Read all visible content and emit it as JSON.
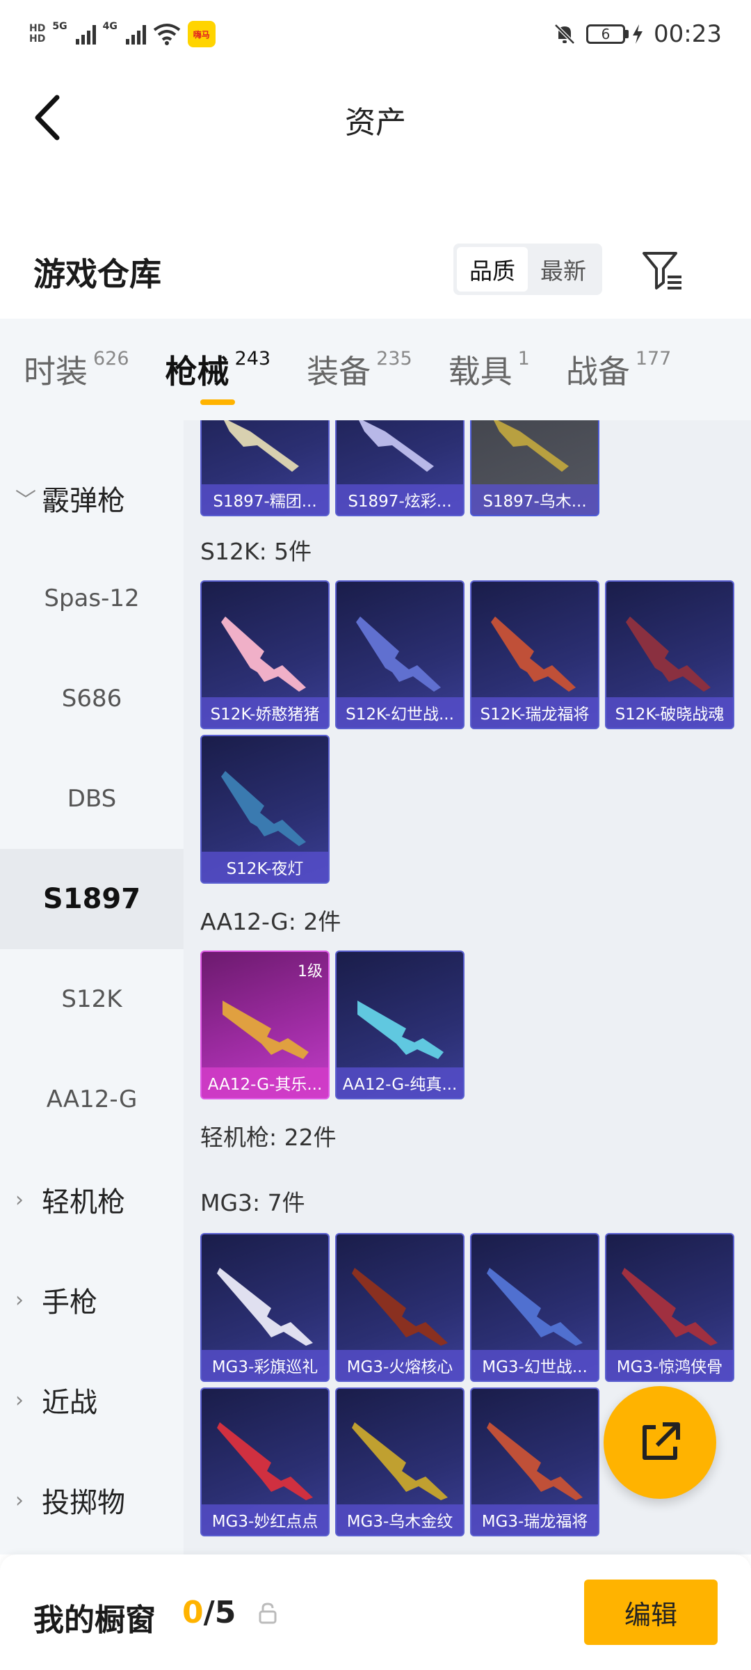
{
  "status_bar": {
    "hd_top": "HD",
    "hd_bottom": "HD",
    "net_5g": "5G",
    "net_4g": "4G",
    "wifi_tag": "6+",
    "app_badge": "嗨马",
    "battery": "6",
    "time": "00:23"
  },
  "header": {
    "title": "资产"
  },
  "section": {
    "title": "游戏仓库",
    "sort_options": [
      "品质",
      "最新"
    ],
    "sort_active": "品质"
  },
  "category_tabs": [
    {
      "label": "时装",
      "count": "626"
    },
    {
      "label": "枪械",
      "count": "243",
      "active": true
    },
    {
      "label": "装备",
      "count": "235"
    },
    {
      "label": "载具",
      "count": "1"
    },
    {
      "label": "战备",
      "count": "177"
    }
  ],
  "sidebar": {
    "group_shotgun": "霰弹枪",
    "items": [
      "Spas-12",
      "S686",
      "DBS",
      "S1897",
      "S12K",
      "AA12-G"
    ],
    "active_item": "S1897",
    "group_lmg": "轻机枪",
    "group_pistol": "手枪",
    "group_melee": "近战",
    "group_throwable": "投掷物"
  },
  "content": {
    "s1897_items": [
      "S1897-糯团...",
      "S1897-炫彩...",
      "S1897-乌木..."
    ],
    "s12k_label": "S12K: 5件",
    "s12k_items": [
      "S12K-娇憨猪猪",
      "S12K-幻世战...",
      "S12K-瑞龙福将",
      "S12K-破晓战魂",
      "S12K-夜灯"
    ],
    "aa12_label": "AA12-G: 2件",
    "aa12_items": [
      "AA12-G-其乐...",
      "AA12-G-纯真..."
    ],
    "aa12_level": "1级",
    "lmg_label": "轻机枪: 22件",
    "mg3_label": "MG3: 7件",
    "mg3_items": [
      "MG3-彩旗巡礼",
      "MG3-火熔核心",
      "MG3-幻世战...",
      "MG3-惊鸿侠骨",
      "MG3-妙红点点",
      "MG3-乌木金纹",
      "MG3-瑞龙福将"
    ]
  },
  "bottom_bar": {
    "title": "我的橱窗",
    "current": "0",
    "sep": "/",
    "max": "5",
    "edit_label": "编辑"
  },
  "colors": {
    "accent": "#ffb300",
    "card_purple": "#2b2f72",
    "card_pink": "#a12da6"
  }
}
